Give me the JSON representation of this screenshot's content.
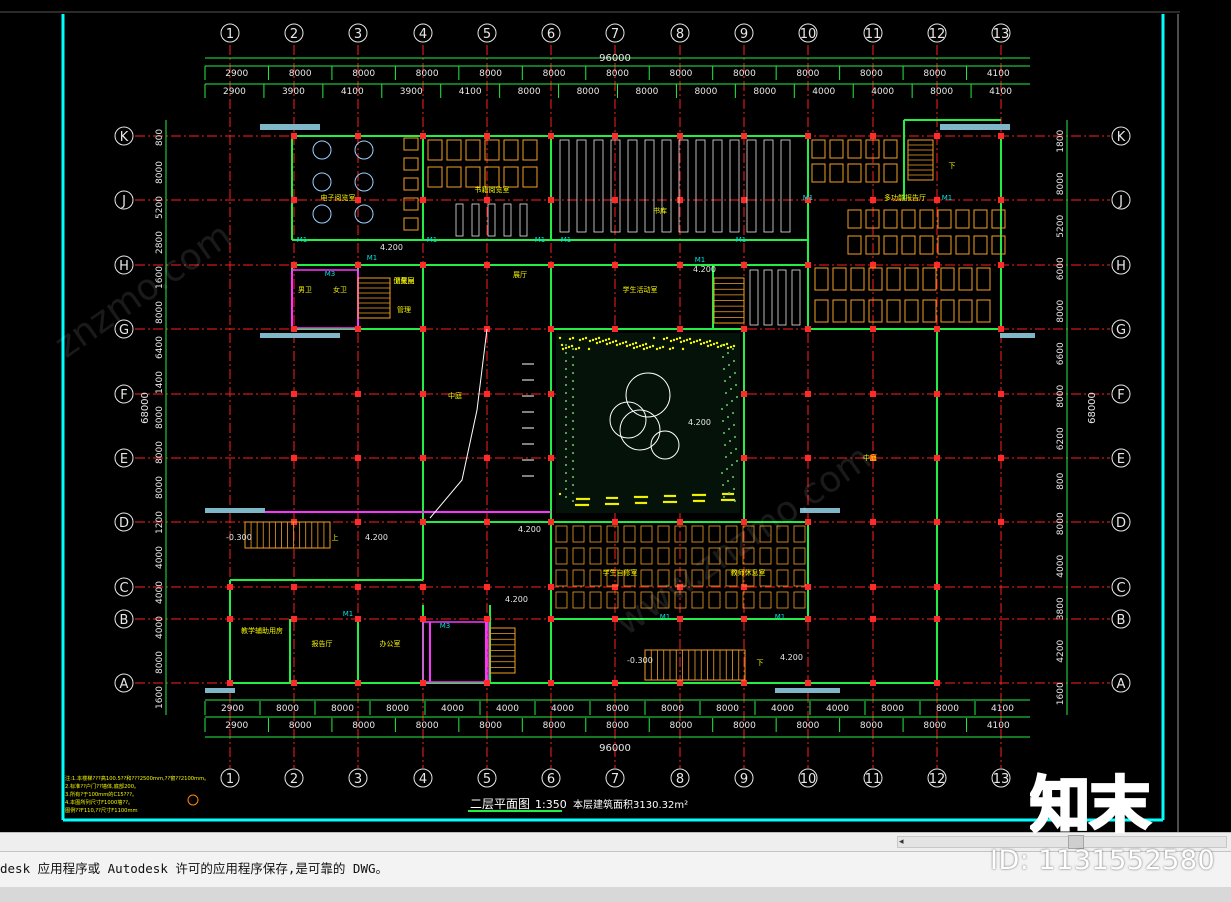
{
  "colors": {
    "canvas": "#000000",
    "frame": "#00ffff",
    "axis_line": "#ff2020",
    "wall_green": "#22ee44",
    "dimension": "#e8e8e8",
    "magenta": "#ff33ff",
    "furniture": "#f2a024",
    "label_yellow": "#f6f600",
    "cmd_bg": "#f3f3f3"
  },
  "drawing": {
    "column_ids": [
      "1",
      "2",
      "3",
      "4",
      "5",
      "6",
      "7",
      "8",
      "9",
      "10",
      "11",
      "12",
      "13"
    ],
    "row_ids": [
      "K",
      "J",
      "H",
      "G",
      "F",
      "E",
      "D",
      "C",
      "B",
      "A"
    ],
    "total_width_dim": "96000",
    "total_height_dim": "68000",
    "top_dims_row1": [
      "2900",
      "8000",
      "8000",
      "8000",
      "8000",
      "8000",
      "8000",
      "8000",
      "8000",
      "8000",
      "8000",
      "8000",
      "4100"
    ],
    "top_dims_row2": [
      "2900",
      "3900",
      "4100",
      "3900",
      "4100",
      "8000",
      "8000",
      "8000",
      "8000",
      "8000",
      "4000",
      "4000",
      "8000",
      "4100"
    ],
    "bottom_dims_row1": [
      "2900",
      "8000",
      "8000",
      "8000",
      "4000",
      "4000",
      "4000",
      "8000",
      "8000",
      "8000",
      "4000",
      "4000",
      "8000",
      "8000",
      "4100"
    ],
    "bottom_dims_row2": [
      "2900",
      "8000",
      "8000",
      "8000",
      "8000",
      "8000",
      "8000",
      "8000",
      "8000",
      "8000",
      "8000",
      "8000",
      "4100"
    ],
    "left_dims_outer": [
      "800",
      "8000",
      "5200",
      "2800",
      "1600",
      "8000",
      "6400",
      "1400",
      "8000",
      "8000",
      "8000",
      "1200",
      "4000",
      "4000",
      "4000",
      "8000",
      "1600"
    ],
    "right_dims_outer": [
      "1800",
      "8000",
      "5200",
      "6000",
      "8000",
      "6600",
      "8000",
      "6200",
      "800",
      "8000",
      "4000",
      "3800",
      "4200",
      "1600"
    ],
    "title": "二层平面图",
    "scale": "1:350",
    "area_note": "本层建筑面积3130.32m²",
    "notes": [
      "注:1.本楼梯???高100.5??和???2500mm,??窗??2100mm。",
      "2.标准??户门??墙体,底部200。",
      "3.所有?于100mm的C15???。",
      "4.本图所列尺寸F1000墙??。",
      "图例??F110,??尺寸F1100mm"
    ],
    "level_marks": [
      "4.200",
      "4.200",
      "4.200",
      "-0.300",
      "4.200",
      "4.200",
      "-0.300",
      "4.200",
      "4.200"
    ],
    "door_tags": [
      "M1",
      "M1",
      "M1",
      "M1",
      "M1",
      "M1",
      "M1",
      "M1",
      "M1",
      "M1",
      "M1",
      "M1",
      "M3",
      "M3"
    ],
    "room_labels": [
      "电子阅览室",
      "书籍阅览室",
      "书库",
      "多功能报告厅",
      "男卫",
      "女卫",
      "卫生间",
      "管理",
      "中庭",
      "展厅",
      "学生活动室",
      "学生自修室",
      "教师休息室",
      "教学辅助用房",
      "报告厅",
      "办公室",
      "储藏室",
      "下",
      "上",
      "下",
      "中庭"
    ]
  },
  "cmdline": {
    "text": "desk 应用程序或 Autodesk 许可的应用程序保存,是可靠的 DWG。"
  },
  "watermark": {
    "id_text": "ID: 1131552580",
    "logo_text": "知末"
  }
}
